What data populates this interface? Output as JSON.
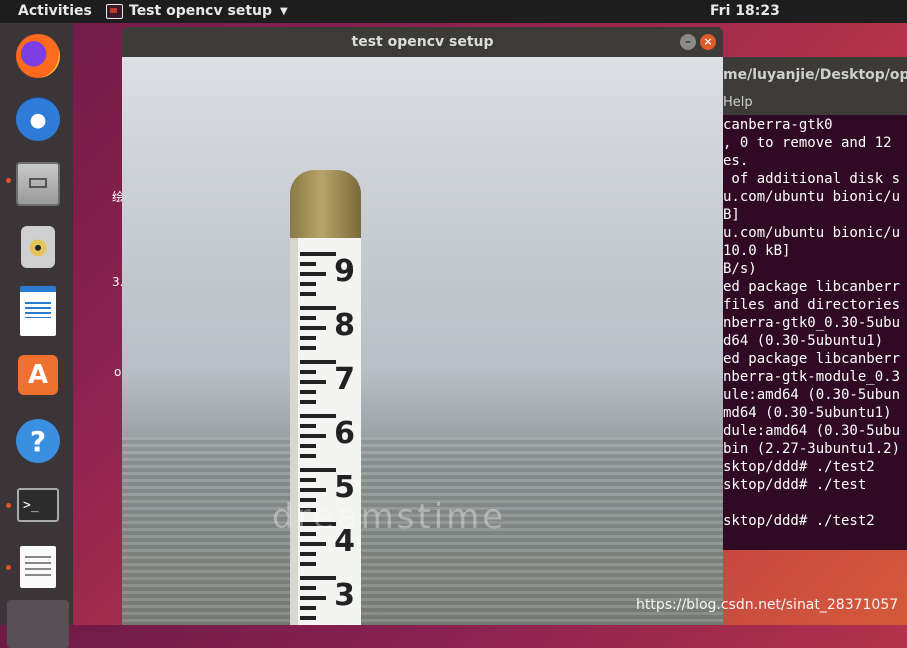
{
  "topbar": {
    "activities": "Activities",
    "app_menu": "Test opencv setup",
    "clock": "Fri 18:23"
  },
  "dock": {
    "items": [
      {
        "name": "Firefox",
        "icon": "firefox-icon"
      },
      {
        "name": "Thunderbird",
        "icon": "thunderbird-icon"
      },
      {
        "name": "Files",
        "icon": "files-icon"
      },
      {
        "name": "Rhythmbox",
        "icon": "rhythmbox-icon"
      },
      {
        "name": "LibreOffice Writer",
        "icon": "writer-icon"
      },
      {
        "name": "Ubuntu Software",
        "icon": "software-icon",
        "glyph": "A"
      },
      {
        "name": "Help",
        "icon": "help-icon",
        "glyph": "?"
      },
      {
        "name": "Terminal",
        "icon": "terminal-icon",
        "glyph": ">_"
      },
      {
        "name": "Text Editor",
        "icon": "text-editor-icon"
      }
    ]
  },
  "desktop_fragments": [
    "绘",
    "3.",
    "o"
  ],
  "terminal": {
    "title": "me/luyanjie/Desktop/oper",
    "menu": "Help",
    "lines": [
      "canberra-gtk0",
      ", 0 to remove and 12",
      "es.",
      " of additional disk s",
      "u.com/ubuntu bionic/u",
      "B]",
      "u.com/ubuntu bionic/u",
      "10.0 kB]",
      "B/s)",
      "ed package libcanberr",
      "files and directories",
      "nberra-gtk0_0.30-5ubu",
      "d64 (0.30-5ubuntu1)",
      "ed package libcanberr",
      "nberra-gtk-module_0.3",
      "ule:amd64 (0.30-5ubun",
      "md64 (0.30-5ubuntu1)",
      "dule:amd64 (0.30-5ubu",
      "bin (2.27-3ubuntu1.2)",
      "sktop/ddd# ./test2",
      "sktop/ddd# ./test",
      "",
      "sktop/ddd# ./test2"
    ]
  },
  "opencv_window": {
    "title": "test opencv setup",
    "minimize": "–",
    "close": "×",
    "gauge_numbers": [
      "9",
      "8",
      "7",
      "6",
      "5",
      "4",
      "3"
    ],
    "watermark": "dreamstime"
  },
  "caption": "https://blog.csdn.net/sinat_28371057",
  "colors": {
    "accent": "#e95420",
    "terminal_bg": "#300a24",
    "titlebar": "#3c3b37"
  }
}
